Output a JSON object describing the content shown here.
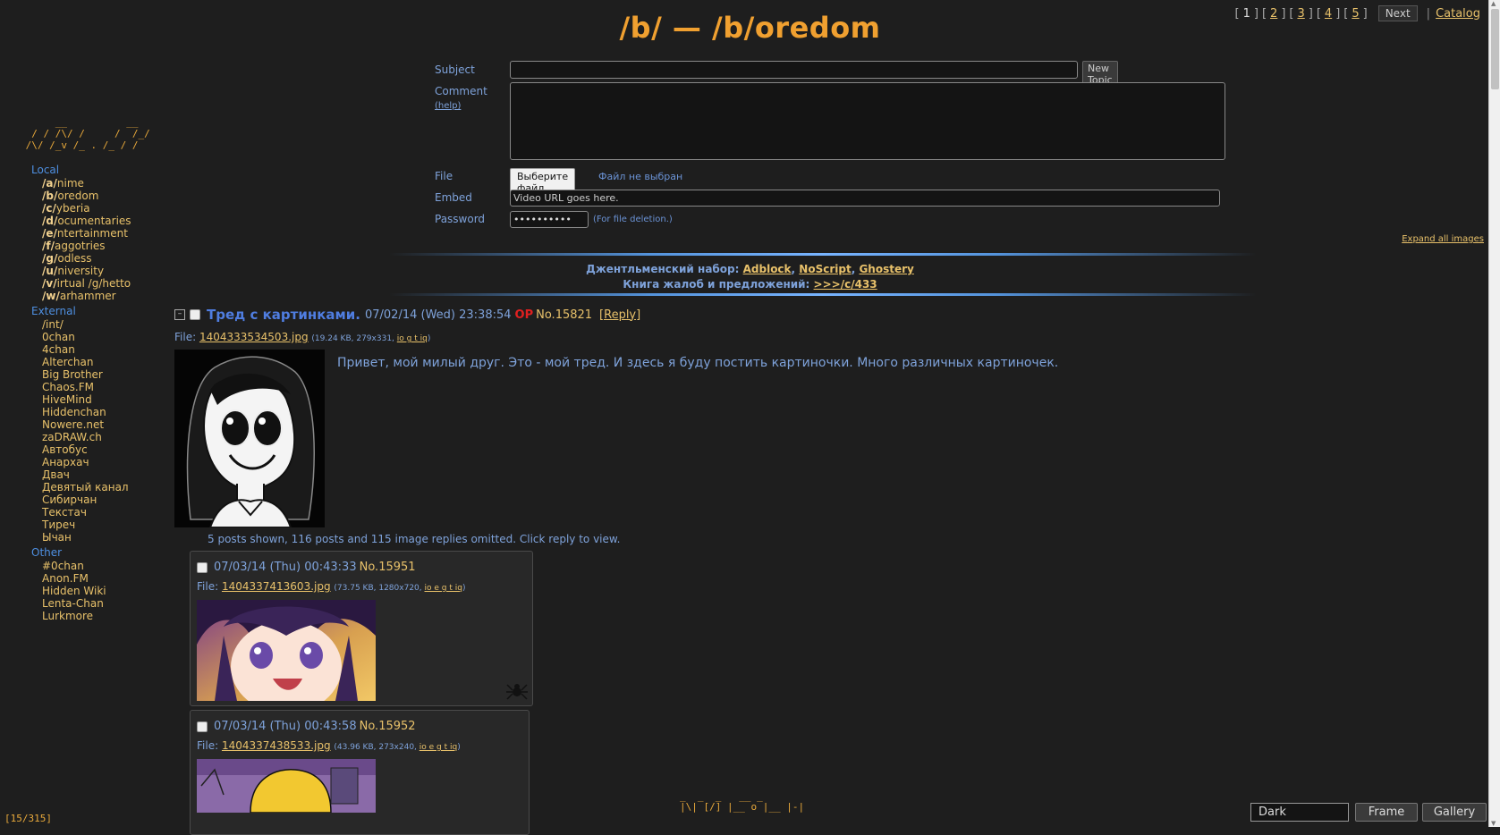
{
  "pager": {
    "pages": [
      "1",
      "2",
      "3",
      "4",
      "5"
    ],
    "next_label": "Next",
    "separator": "|",
    "catalog_label": "Catalog"
  },
  "title": "/b/ — /b/oredom",
  "logo_ascii": "      __          __\n  / / /\\/ /     /  /_/\n /\\/ /_v /_ . /_ / /",
  "sidebar": {
    "groups": [
      {
        "label": "Local",
        "items": [
          {
            "prefix": "/a/",
            "rest": "nime"
          },
          {
            "prefix": "/b/",
            "rest": "oredom"
          },
          {
            "prefix": "/c/",
            "rest": "yberia"
          },
          {
            "prefix": "/d/",
            "rest": "ocumentaries"
          },
          {
            "prefix": "/e/",
            "rest": "ntertainment"
          },
          {
            "prefix": "/f/",
            "rest": "aggotries"
          },
          {
            "prefix": "/g/",
            "rest": "odless"
          },
          {
            "prefix": "/u/",
            "rest": "niversity"
          },
          {
            "prefix": "/v/",
            "rest": "irtual /g/hetto"
          },
          {
            "prefix": "/w/",
            "rest": "arhammer"
          }
        ]
      },
      {
        "label": "External",
        "items": [
          {
            "prefix": "",
            "rest": "/int/"
          },
          {
            "prefix": "",
            "rest": "0chan"
          },
          {
            "prefix": "",
            "rest": "4chan"
          },
          {
            "prefix": "",
            "rest": "Alterchan"
          },
          {
            "prefix": "",
            "rest": "Big Brother"
          },
          {
            "prefix": "",
            "rest": "Chaos.FM"
          },
          {
            "prefix": "",
            "rest": "HiveMind"
          },
          {
            "prefix": "",
            "rest": "Hiddenchan"
          },
          {
            "prefix": "",
            "rest": "Nowere.net"
          },
          {
            "prefix": "",
            "rest": "zaDRAW.ch"
          },
          {
            "prefix": "",
            "rest": "Автобус"
          },
          {
            "prefix": "",
            "rest": "Анархач"
          },
          {
            "prefix": "",
            "rest": "Двач"
          },
          {
            "prefix": "",
            "rest": "Девятый канал"
          },
          {
            "prefix": "",
            "rest": "Сибирчан"
          },
          {
            "prefix": "",
            "rest": "Текстач"
          },
          {
            "prefix": "",
            "rest": "Тиреч"
          },
          {
            "prefix": "",
            "rest": "Ычан"
          }
        ]
      },
      {
        "label": "Other",
        "items": [
          {
            "prefix": "",
            "rest": "#0chan"
          },
          {
            "prefix": "",
            "rest": "Anon.FM"
          },
          {
            "prefix": "",
            "rest": "Hidden Wiki"
          },
          {
            "prefix": "",
            "rest": "Lenta-Chan"
          },
          {
            "prefix": "",
            "rest": "Lurkmore"
          }
        ]
      }
    ]
  },
  "form": {
    "subject_label": "Subject",
    "subject_value": "",
    "new_topic_label": "New Topic",
    "comment_label": "Comment",
    "help_label": "(help)",
    "file_label": "File",
    "file_button": "Выберите файл",
    "file_status": "Файл не выбран",
    "embed_label": "Embed",
    "embed_value": "Video URL goes here.",
    "password_label": "Password",
    "password_value": "••••••••••",
    "password_note": "(For file deletion.)"
  },
  "expand_all": "Expand all images",
  "announce": {
    "line1_prefix": "Джентльменский набор:",
    "links": [
      "Adblock",
      "NoScript",
      "Ghostery"
    ],
    "line2_prefix": "Книга жалоб и предложений:",
    "line2_link": ">>>/c/433"
  },
  "thread": {
    "collapse": "–",
    "subject": "Тред с картинками.",
    "date": "07/02/14 (Wed) 23:38:54",
    "op_badge": "OP",
    "number": "No.15821",
    "reply_label": "[Reply]",
    "file_prefix": "File:",
    "file_name": "1404333534503.jpg",
    "file_meta_open": "(19.24 KB, 279x331,",
    "file_meta_links": "io g t iq",
    "file_meta_close": ")",
    "comment": "Привет, мой милый друг. Это - мой тред. И здесь я буду постить картиночки. Много различных картиночек.",
    "omitted": "5 posts shown, 116 posts and 115 image replies omitted. Click reply to view."
  },
  "replies": [
    {
      "date": "07/03/14 (Thu) 00:43:33",
      "number": "No.15951",
      "file_prefix": "File:",
      "file_name": "1404337413603.jpg",
      "file_meta_open": "(73.75 KB, 1280x720,",
      "file_meta_links": "io e g t iq",
      "file_meta_close": ")"
    },
    {
      "date": "07/03/14 (Thu) 00:43:58",
      "number": "No.15952",
      "file_prefix": "File:",
      "file_name": "1404337438533.jpg",
      "file_meta_open": "(43.96 KB, 273x240,",
      "file_meta_links": "io e g t iq",
      "file_meta_close": ")"
    }
  ],
  "bottom": {
    "counter": "[15/315]",
    "logo_ascii": "_  _  _   __ _\n|\\| [/] |__ o |__ |-|",
    "style_value": "Dark",
    "frame_label": "Frame",
    "gallery_label": "Gallery"
  },
  "colors": {
    "background": "#1e1e1e",
    "title": "#f0a030",
    "link": "#e8c16a",
    "text": "#7ea2da",
    "op_badge": "#e02020"
  }
}
